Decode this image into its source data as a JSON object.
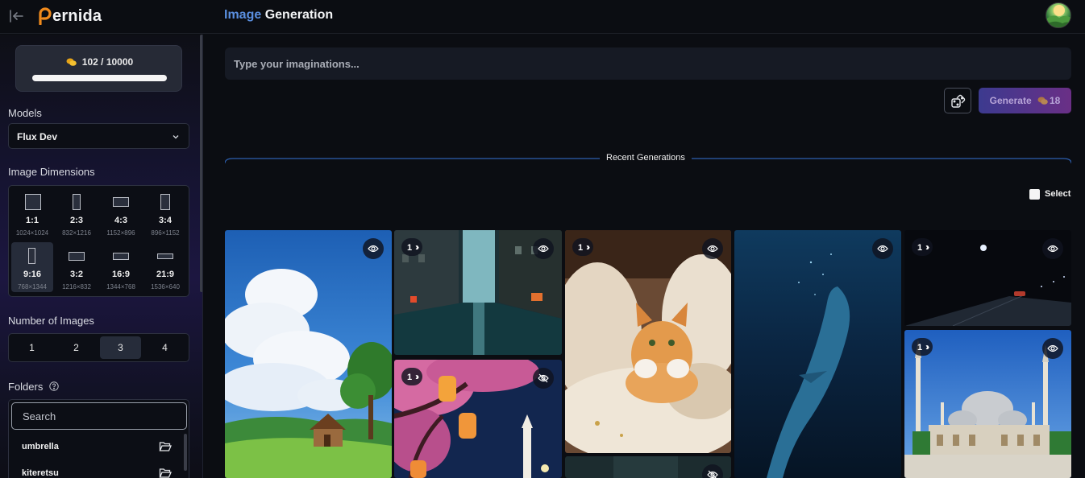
{
  "app": {
    "logo_text": "ernida",
    "page_title_accent": "Image",
    "page_title_rest": "Generation"
  },
  "sidebar": {
    "credits": "102 / 10000",
    "credits_used_fraction": 1.0,
    "models_label": "Models",
    "model_selected": "Flux Dev",
    "dimensions_label": "Image Dimensions",
    "dimensions": [
      {
        "ratio": "1:1",
        "res": "1024×1024"
      },
      {
        "ratio": "2:3",
        "res": "832×1216"
      },
      {
        "ratio": "4:3",
        "res": "1152×896"
      },
      {
        "ratio": "3:4",
        "res": "896×1152"
      },
      {
        "ratio": "9:16",
        "res": "768×1344",
        "active": true
      },
      {
        "ratio": "3:2",
        "res": "1216×832"
      },
      {
        "ratio": "16:9",
        "res": "1344×768"
      },
      {
        "ratio": "21:9",
        "res": "1536×640"
      }
    ],
    "number_label": "Number of Images",
    "numbers": [
      "1",
      "2",
      "3",
      "4"
    ],
    "number_selected": "3",
    "folders_label": "Folders",
    "folder_search_placeholder": "Search",
    "folders": [
      "umbrella",
      "kiteretsu"
    ]
  },
  "main": {
    "prompt_placeholder": "Type your imaginations...",
    "generate_label": "Generate",
    "generate_cost": "18",
    "recent_label": "Recent Generations",
    "select_label": "Select"
  },
  "gallery": [
    {
      "name": "cloud-landscape",
      "badge": ""
    },
    {
      "name": "rainy-street",
      "badge": "1"
    },
    {
      "name": "cherry-lanterns",
      "badge": "1"
    },
    {
      "name": "orange-kitten",
      "badge": "1"
    },
    {
      "name": "dark-teal",
      "badge": ""
    },
    {
      "name": "underwater-whale",
      "badge": ""
    },
    {
      "name": "night-road",
      "badge": "1"
    },
    {
      "name": "mosque",
      "badge": "1"
    }
  ]
}
